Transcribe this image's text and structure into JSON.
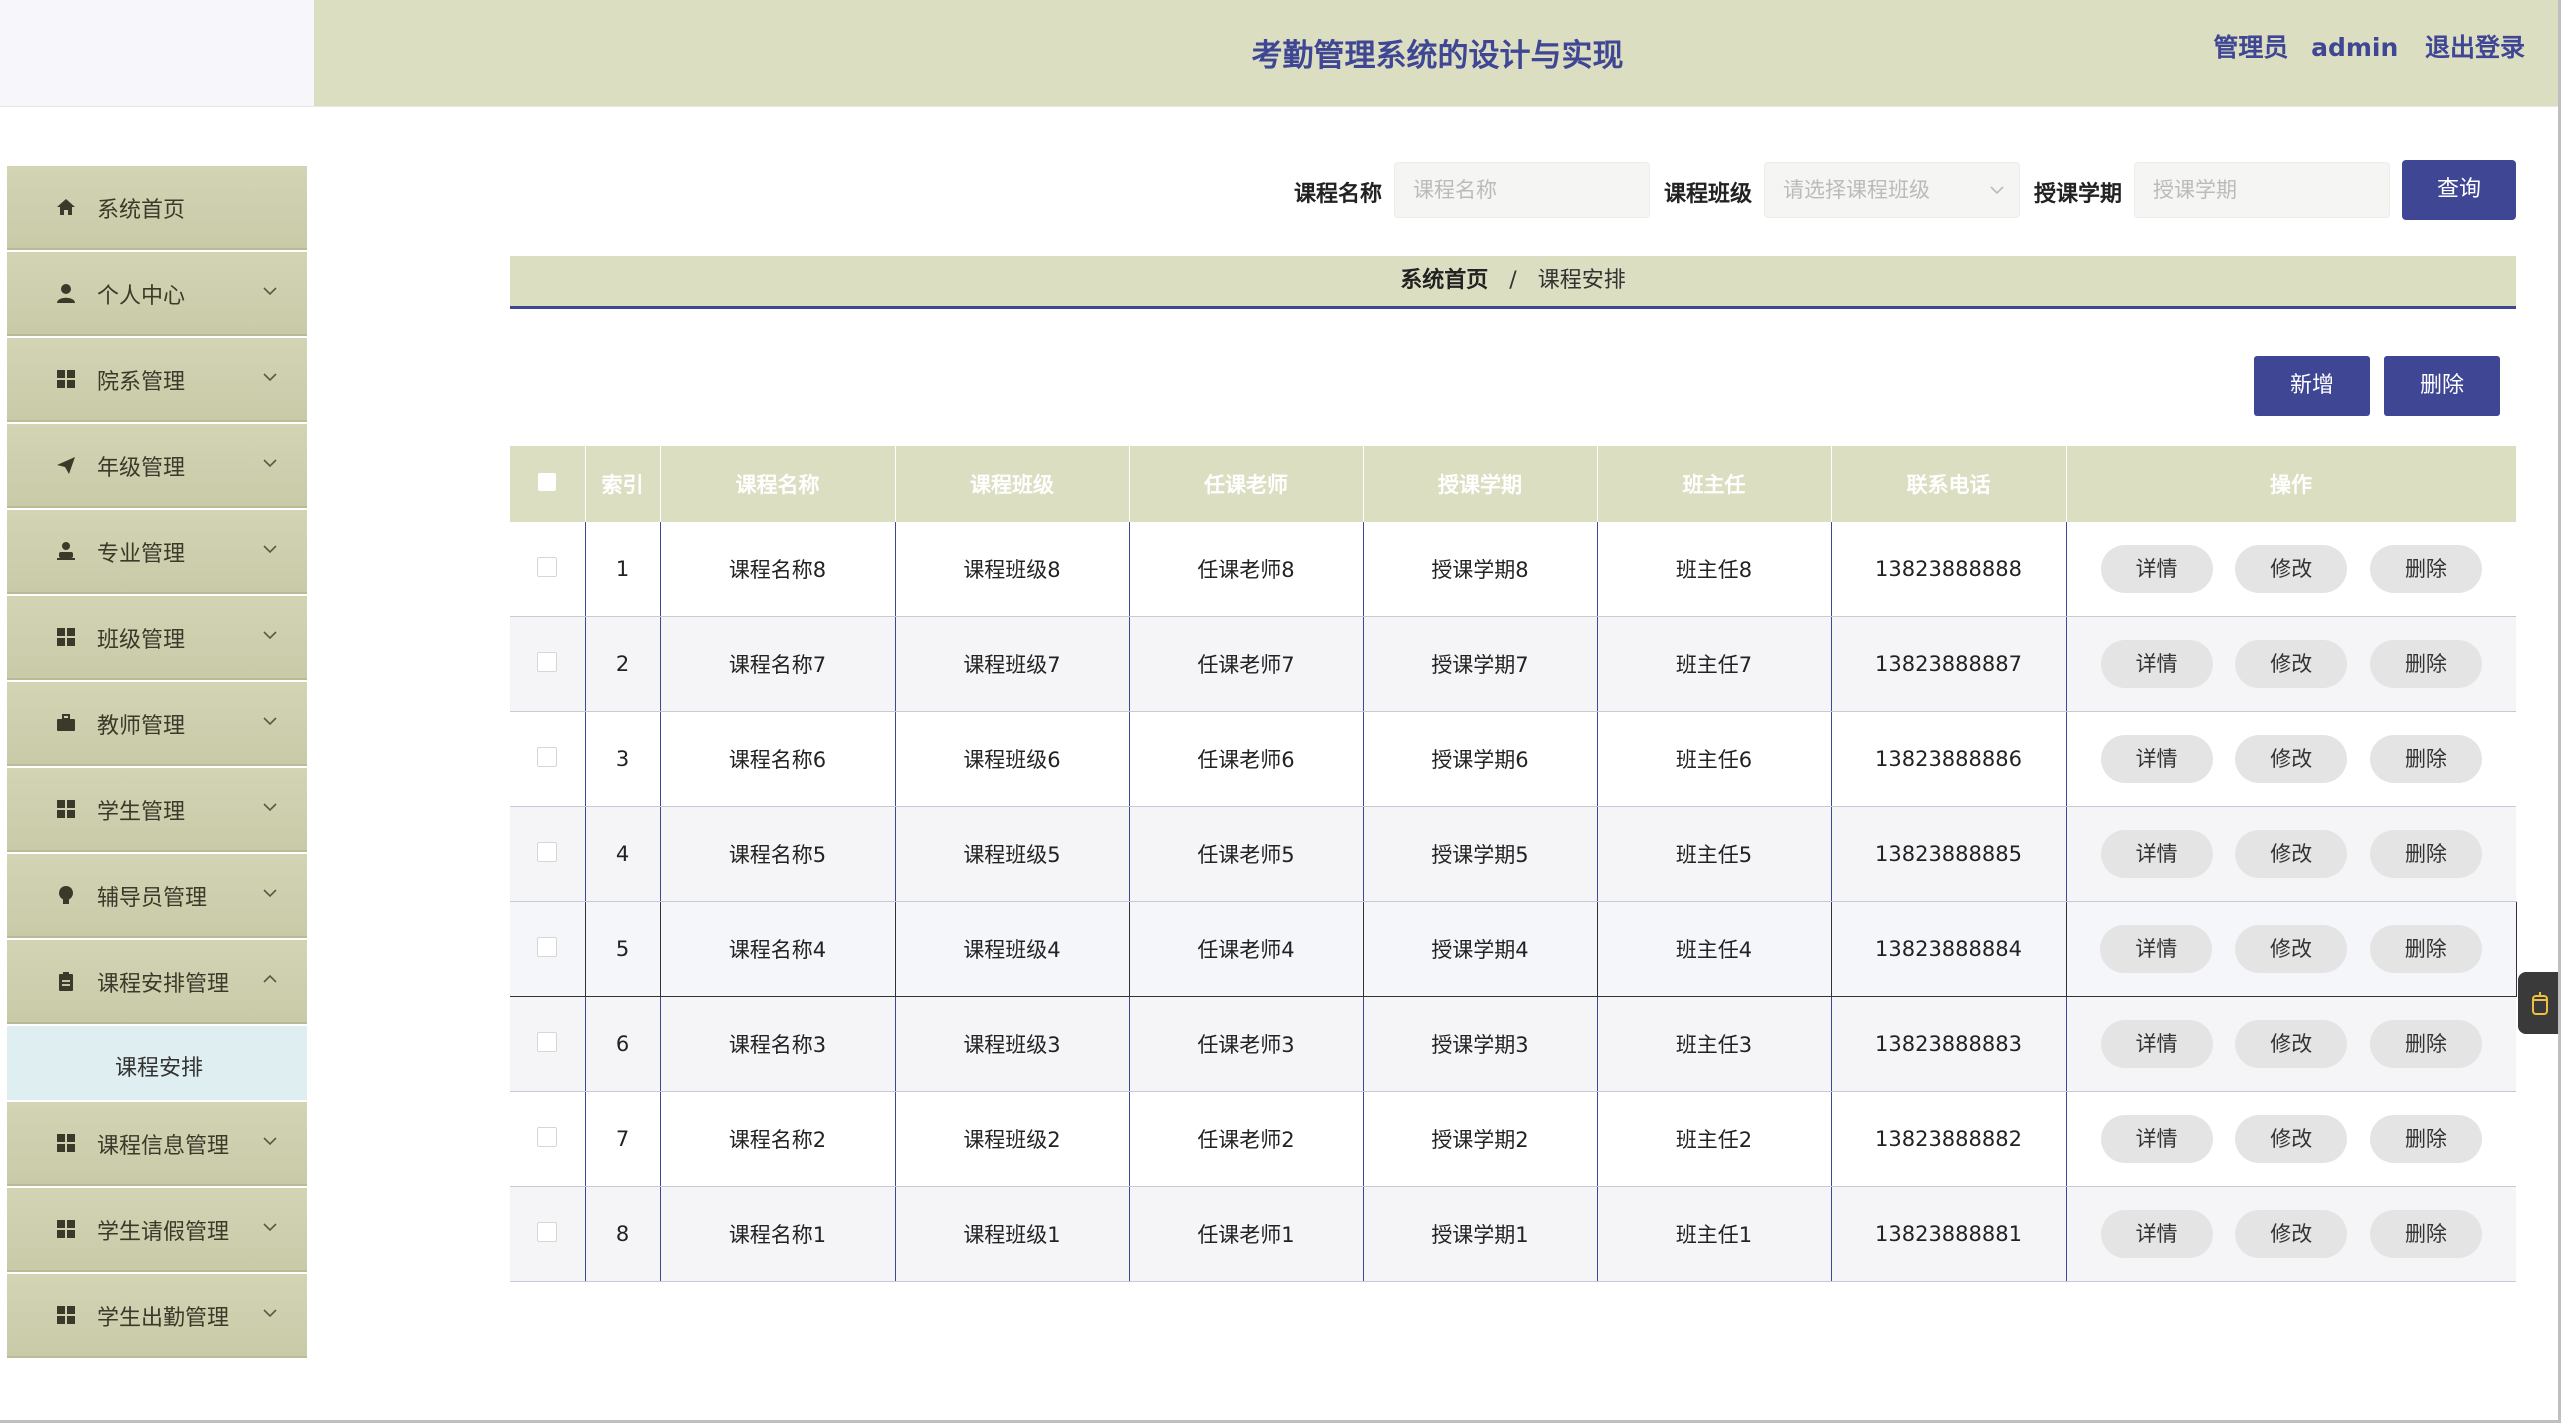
{
  "header": {
    "title": "考勤管理系统的设计与实现",
    "user_role": "管理员",
    "user_name": "admin",
    "logout": "退出登录"
  },
  "sidebar": {
    "items": [
      {
        "label": "系统首页",
        "icon": "home-icon",
        "expanded": null
      },
      {
        "label": "个人中心",
        "icon": "user-icon",
        "expanded": false
      },
      {
        "label": "院系管理",
        "icon": "grid-icon",
        "expanded": false
      },
      {
        "label": "年级管理",
        "icon": "send-icon",
        "expanded": false
      },
      {
        "label": "专业管理",
        "icon": "person-icon",
        "expanded": false
      },
      {
        "label": "班级管理",
        "icon": "grid-icon",
        "expanded": false
      },
      {
        "label": "教师管理",
        "icon": "briefcase-icon",
        "expanded": false
      },
      {
        "label": "学生管理",
        "icon": "grid-icon",
        "expanded": false
      },
      {
        "label": "辅导员管理",
        "icon": "bulb-icon",
        "expanded": false
      },
      {
        "label": "课程安排管理",
        "icon": "clipboard-icon",
        "expanded": true
      },
      {
        "label": "课程信息管理",
        "icon": "grid-icon",
        "expanded": false
      },
      {
        "label": "学生请假管理",
        "icon": "grid-icon",
        "expanded": false
      },
      {
        "label": "学生出勤管理",
        "icon": "grid-icon",
        "expanded": false
      }
    ],
    "sub_item": "课程安排"
  },
  "search": {
    "course_name_label": "课程名称",
    "course_name_placeholder": "课程名称",
    "course_class_label": "课程班级",
    "course_class_placeholder": "请选择课程班级",
    "term_label": "授课学期",
    "term_placeholder": "授课学期",
    "query": "查询"
  },
  "breadcrumb": {
    "home": "系统首页",
    "separator": "/",
    "current": "课程安排"
  },
  "actions": {
    "add": "新增",
    "delete": "删除"
  },
  "table": {
    "headers": [
      "索引",
      "课程名称",
      "课程班级",
      "任课老师",
      "授课学期",
      "班主任",
      "联系电话",
      "操作"
    ],
    "op_labels": {
      "detail": "详情",
      "edit": "修改",
      "delete": "删除"
    },
    "rows": [
      [
        "1",
        "课程名称8",
        "课程班级8",
        "任课老师8",
        "授课学期8",
        "班主任8",
        "13823888888"
      ],
      [
        "2",
        "课程名称7",
        "课程班级7",
        "任课老师7",
        "授课学期7",
        "班主任7",
        "13823888887"
      ],
      [
        "3",
        "课程名称6",
        "课程班级6",
        "任课老师6",
        "授课学期6",
        "班主任6",
        "13823888886"
      ],
      [
        "4",
        "课程名称5",
        "课程班级5",
        "任课老师5",
        "授课学期5",
        "班主任5",
        "13823888885"
      ],
      [
        "5",
        "课程名称4",
        "课程班级4",
        "任课老师4",
        "授课学期4",
        "班主任4",
        "13823888884"
      ],
      [
        "6",
        "课程名称3",
        "课程班级3",
        "任课老师3",
        "授课学期3",
        "班主任3",
        "13823888883"
      ],
      [
        "7",
        "课程名称2",
        "课程班级2",
        "任课老师2",
        "授课学期2",
        "班主任2",
        "13823888882"
      ],
      [
        "8",
        "课程名称1",
        "课程班级1",
        "任课老师1",
        "授课学期1",
        "班主任1",
        "13823888881"
      ]
    ]
  },
  "colors": {
    "accent": "#3f4694",
    "header_bg": "#dcdec2",
    "menu_bg": "#d3d4b4",
    "sub_item_bg": "#dfeef0"
  }
}
